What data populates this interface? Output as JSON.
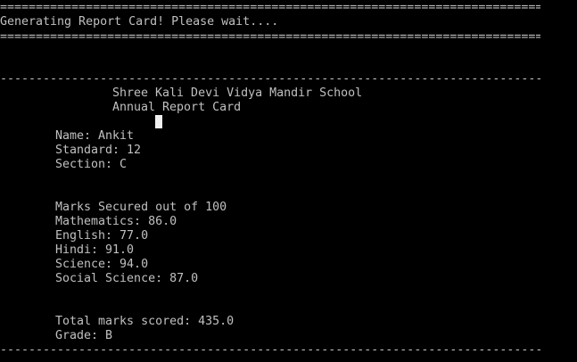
{
  "console": {
    "banner_rule_double": "=======================================================================================================",
    "status_message": "Generating Report Card! Please wait....",
    "section_rule_dash": "-------------------------------------------------------------------------------------------------------",
    "school_name": "Shree Kali Devi Vidya Mandir School",
    "report_title": "Annual Report Card",
    "student": {
      "name_line": "Name: Ankit",
      "standard_line": "Standard: 12",
      "section_line": "Section: C"
    },
    "marks_header": "Marks Secured out of 100",
    "subjects": [
      "Mathematics: 86.0",
      "English: 77.0",
      "Hindi: 91.0",
      "Science: 94.0",
      "Social Science: 87.0"
    ],
    "total_line": "Total marks scored: 435.0",
    "grade_line": "Grade: B"
  },
  "colors": {
    "background": "#000000",
    "text": "#c0c0c0",
    "cursor": "#f0f0f0"
  }
}
